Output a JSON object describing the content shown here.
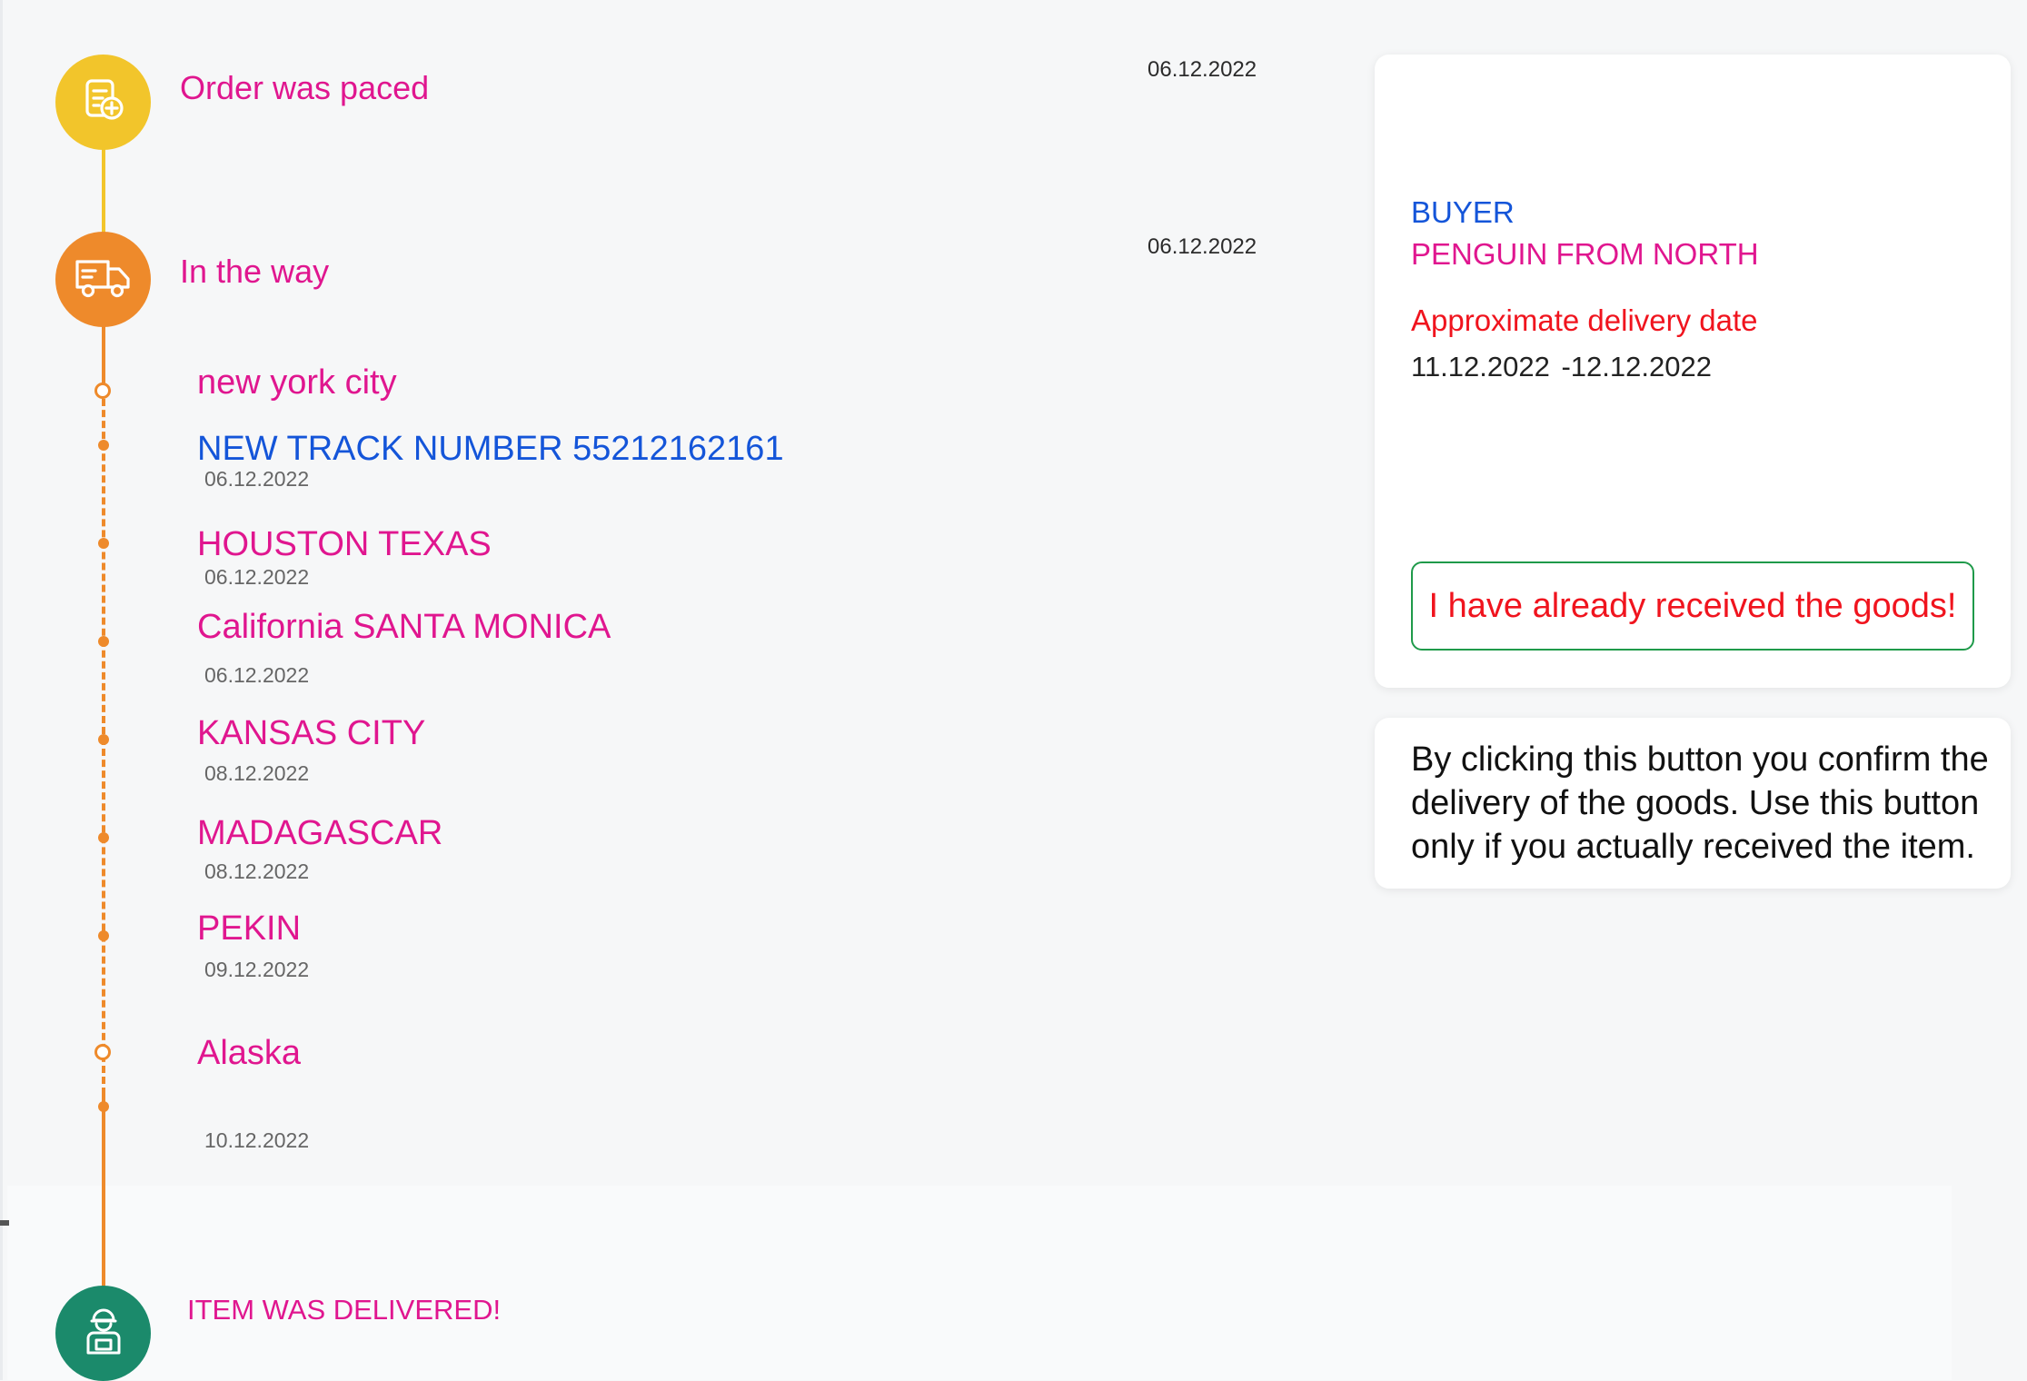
{
  "colors": {
    "accent_pink": "#e0168f",
    "accent_blue": "#1455d9",
    "warning_red": "#f0141e",
    "step_yellow": "#f2c52b",
    "step_orange": "#ee8a2b",
    "step_green": "#1b8a6b",
    "button_border_green": "#1f9a4a"
  },
  "steps": [
    {
      "title": "Order was paced",
      "date": "06.12.2022",
      "icon": "order-document-icon"
    },
    {
      "title": "In the way",
      "date": "06.12.2022",
      "icon": "delivery-truck-icon"
    },
    {
      "title": "ITEM WAS DELIVERED!",
      "icon": "courier-package-icon"
    }
  ],
  "tracking": [
    {
      "name": "new york city",
      "date": ""
    },
    {
      "name": "NEW TRACK NUMBER 55212162161",
      "date": "06.12.2022"
    },
    {
      "name": "HOUSTON TEXAS",
      "date": "06.12.2022"
    },
    {
      "name": "California SANTA MONICA",
      "date": "06.12.2022"
    },
    {
      "name": "KANSAS CITY",
      "date": "08.12.2022"
    },
    {
      "name": "MADAGASCAR",
      "date": "08.12.2022"
    },
    {
      "name": "PEKIN",
      "date": "09.12.2022"
    },
    {
      "name": "Alaska",
      "date": "10.12.2022"
    }
  ],
  "buyer": {
    "label": "BUYER",
    "name": "PENGUIN FROM NORTH"
  },
  "delivery": {
    "label": "Approximate delivery date",
    "range": "11.12.2022  -12.12.2022"
  },
  "confirm_button": {
    "label": "I have already received the goods!"
  },
  "note": {
    "text": "By clicking this button you confirm the delivery of the goods. Use this button only if you actually received the item."
  }
}
